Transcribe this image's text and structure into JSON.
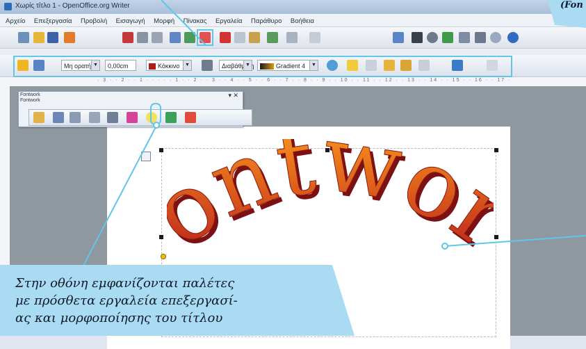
{
  "window": {
    "title": "Χωρίς τίτλο 1 - OpenOffice.org Writer"
  },
  "menu": {
    "items": [
      "Αρχείο",
      "Επεξεργασία",
      "Προβολή",
      "Εισαγωγή",
      "Μορφή",
      "Πίνακας",
      "Εργαλεία",
      "Παράθυρο",
      "Βοήθεια"
    ]
  },
  "drawing_toolbar": {
    "line_style": "Μη ορατή",
    "line_width": "0,00cm",
    "line_color": "Κόκκινο",
    "area_style": "Διαβάθμιση",
    "area_fill": "Gradient 4"
  },
  "ruler": {
    "marks": "· 3 · · 2 · · 1 · · · · · 1 · · 2 · · 3 · · 4 · · 5 · · 6 · · 7 · · 8 · · 9 · · 10 · · 11 · · 12 · · 13 · · 14 · · 15 · · 16 · · 17 ·"
  },
  "palette": {
    "title_outer": "Fontwork ",
    "title_inner": "Fontwork"
  },
  "fontwork_text": "Fontwork",
  "callout_bottom": {
    "line1": "Στην οθόνη εμφανίζονται παλέτες",
    "line2": "με πρόσθετα εργαλεία επεξεργασί-",
    "line3": "ας και μορφοποίησης του τίτλου"
  },
  "callout_top": {
    "text": "(Fon"
  },
  "colors": {
    "callout_fill": "#a9dcf3",
    "highlight": "#5fc6ea",
    "fontwork_red": "#b5161b",
    "fontwork_orange": "#ee7f1c",
    "fontwork_yellow": "#f7e23c"
  }
}
